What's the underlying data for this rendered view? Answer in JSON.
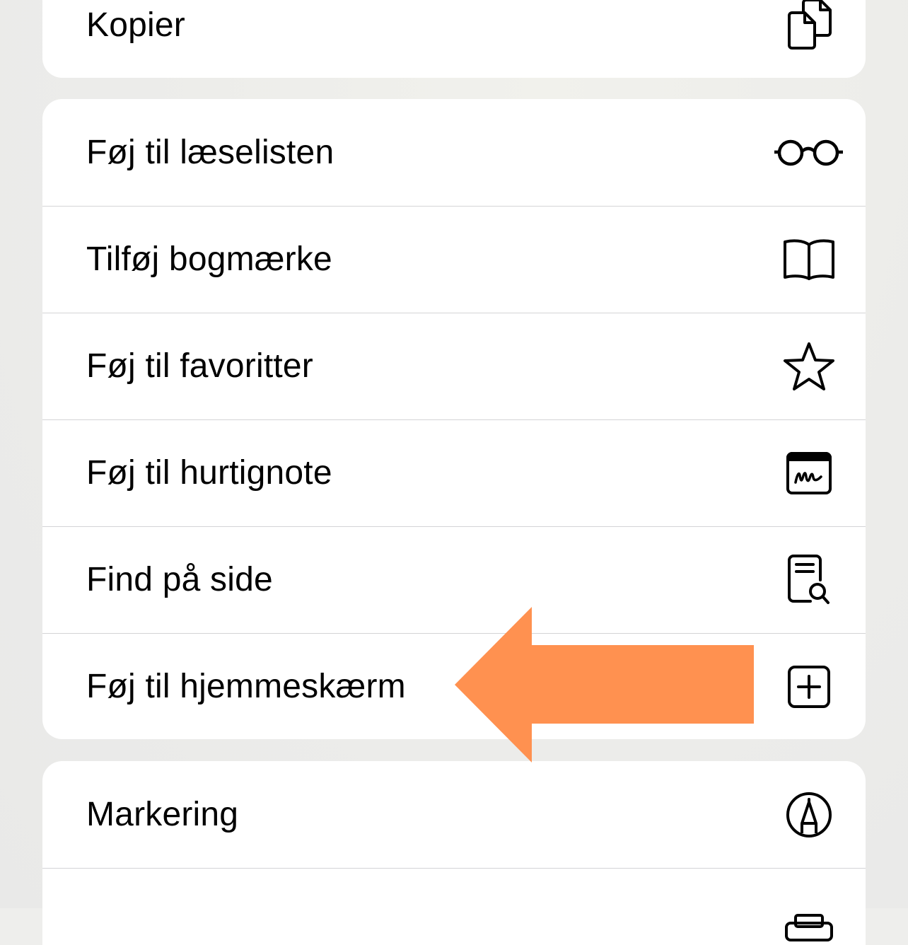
{
  "accent": {
    "arrow_color": "#ff9150"
  },
  "menu": {
    "group_top": {
      "items": [
        {
          "label": "Kopier",
          "icon": "copy-icon"
        }
      ]
    },
    "group_main": {
      "items": [
        {
          "label": "Føj til læselisten",
          "icon": "glasses-icon"
        },
        {
          "label": "Tilføj bogmærke",
          "icon": "book-icon"
        },
        {
          "label": "Føj til favoritter",
          "icon": "star-icon"
        },
        {
          "label": "Føj til hurtignote",
          "icon": "quick-note-icon"
        },
        {
          "label": "Find på side",
          "icon": "find-on-page-icon"
        },
        {
          "label": "Føj til hjemmeskærm",
          "icon": "add-square-icon"
        }
      ]
    },
    "group_bottom": {
      "items": [
        {
          "label": "Markering",
          "icon": "markup-pen-icon"
        },
        {
          "label": "",
          "icon": "print-icon"
        }
      ]
    }
  },
  "annotation": {
    "arrow_target": "Føj til hjemmeskærm"
  }
}
